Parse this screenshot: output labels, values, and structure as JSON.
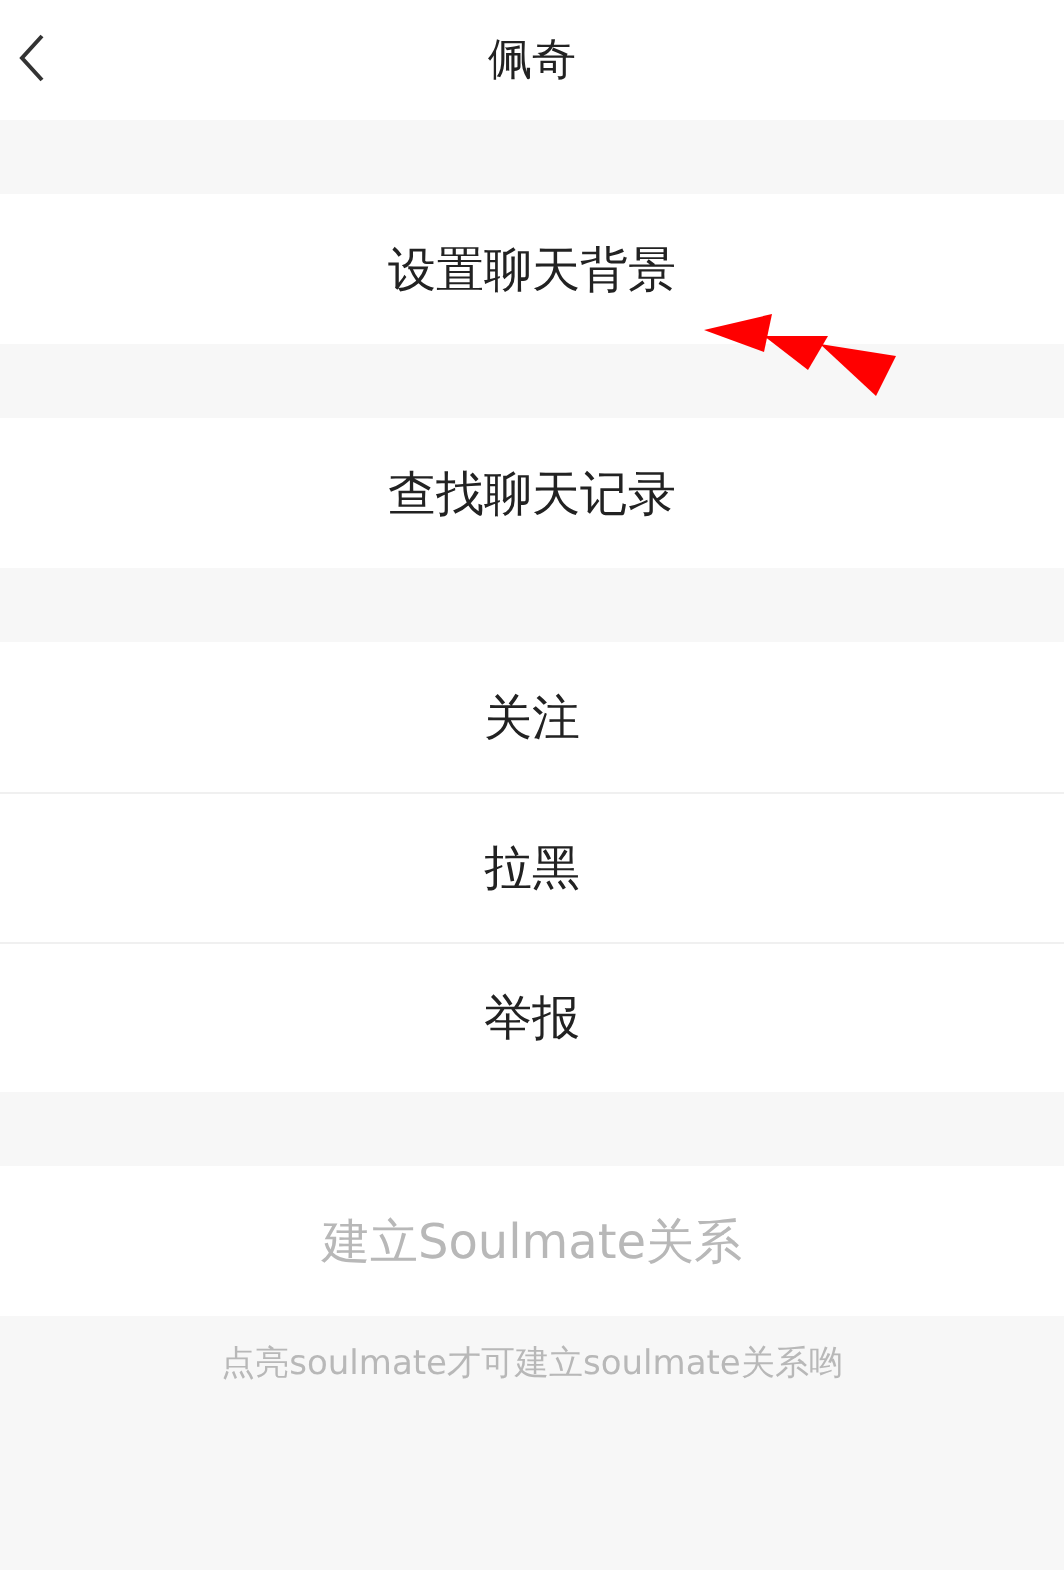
{
  "header": {
    "title": "佩奇"
  },
  "groups": [
    {
      "items": [
        {
          "label": "设置聊天背景",
          "disabled": false
        }
      ]
    },
    {
      "items": [
        {
          "label": "查找聊天记录",
          "disabled": false
        }
      ]
    },
    {
      "items": [
        {
          "label": "关注",
          "disabled": false
        },
        {
          "label": "拉黑",
          "disabled": false
        },
        {
          "label": "举报",
          "disabled": false
        }
      ]
    },
    {
      "items": [
        {
          "label": "建立Soulmate关系",
          "disabled": true
        }
      ]
    }
  ],
  "note": "点亮soulmate才可建立soulmate关系哟"
}
